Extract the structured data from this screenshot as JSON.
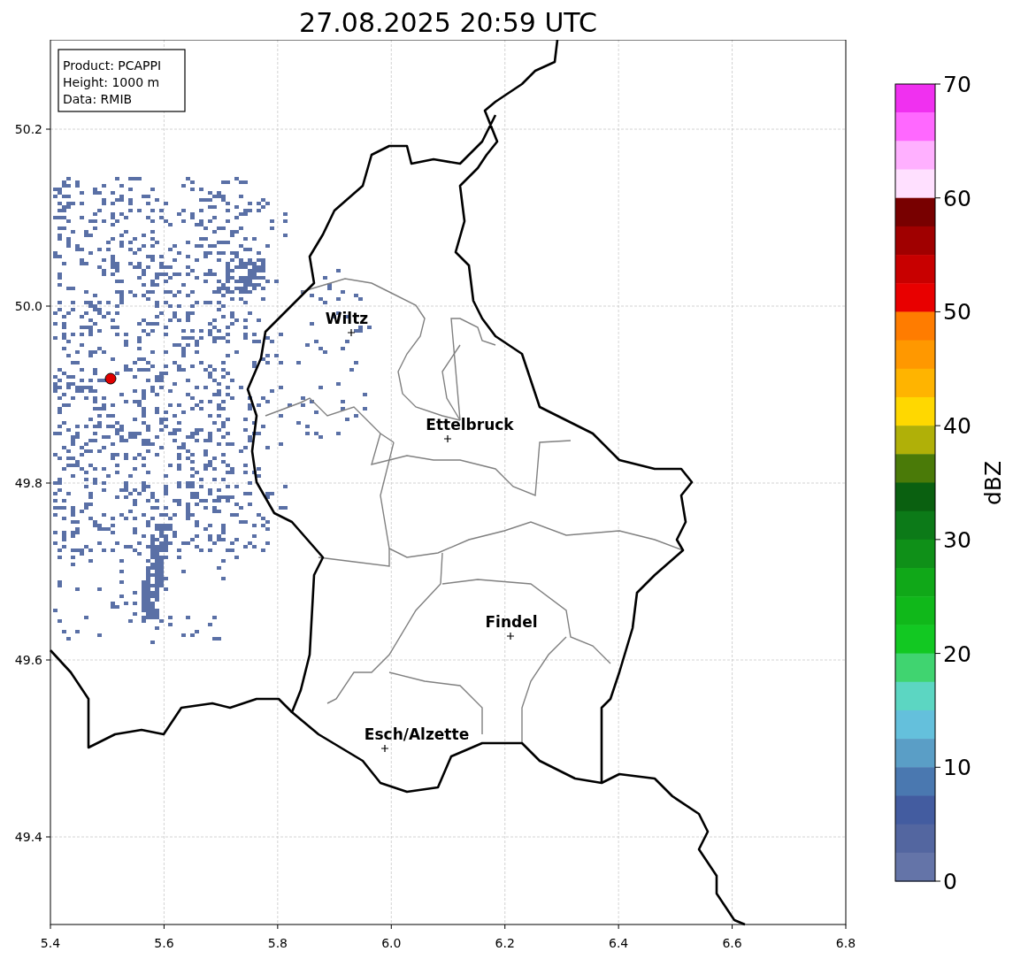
{
  "title": "27.08.2025 20:59 UTC",
  "info_box": [
    "Product: PCAPPI",
    "Height: 1000 m",
    "Data: RMIB"
  ],
  "map": {
    "x_ticks": [
      "5.4",
      "5.6",
      "5.8",
      "6.0",
      "6.2",
      "6.4",
      "6.6",
      "6.8"
    ],
    "y_ticks": [
      "50.2",
      "50.0",
      "49.8",
      "49.6",
      "49.4"
    ],
    "cities": [
      {
        "name": "Wiltz"
      },
      {
        "name": "Ettelbruck"
      },
      {
        "name": "Findel"
      },
      {
        "name": "Esch/Alzette"
      }
    ]
  },
  "colorbar": {
    "label": "dBZ",
    "ticks": [
      "70",
      "60",
      "50",
      "40",
      "30",
      "20",
      "10",
      "0"
    ],
    "segments": [
      {
        "color": "#f030f0"
      },
      {
        "color": "#ff68ff"
      },
      {
        "color": "#ffb0ff"
      },
      {
        "color": "#ffe0ff"
      },
      {
        "color": "#780000"
      },
      {
        "color": "#a00000"
      },
      {
        "color": "#c80000"
      },
      {
        "color": "#e80000"
      },
      {
        "color": "#ff7c00"
      },
      {
        "color": "#ff9800"
      },
      {
        "color": "#ffb400"
      },
      {
        "color": "#ffd800"
      },
      {
        "color": "#b0b008"
      },
      {
        "color": "#4a7a08"
      },
      {
        "color": "#0a6010"
      },
      {
        "color": "#0c7a18"
      },
      {
        "color": "#0f9018"
      },
      {
        "color": "#10a818"
      },
      {
        "color": "#10b81a"
      },
      {
        "color": "#12c822"
      },
      {
        "color": "#40d470"
      },
      {
        "color": "#5cd6c2"
      },
      {
        "color": "#64c0dc"
      },
      {
        "color": "#5a9ec6"
      },
      {
        "color": "#4a78b0"
      },
      {
        "color": "#435ca0"
      },
      {
        "color": "#5366a0"
      },
      {
        "color": "#6474a8"
      }
    ]
  }
}
